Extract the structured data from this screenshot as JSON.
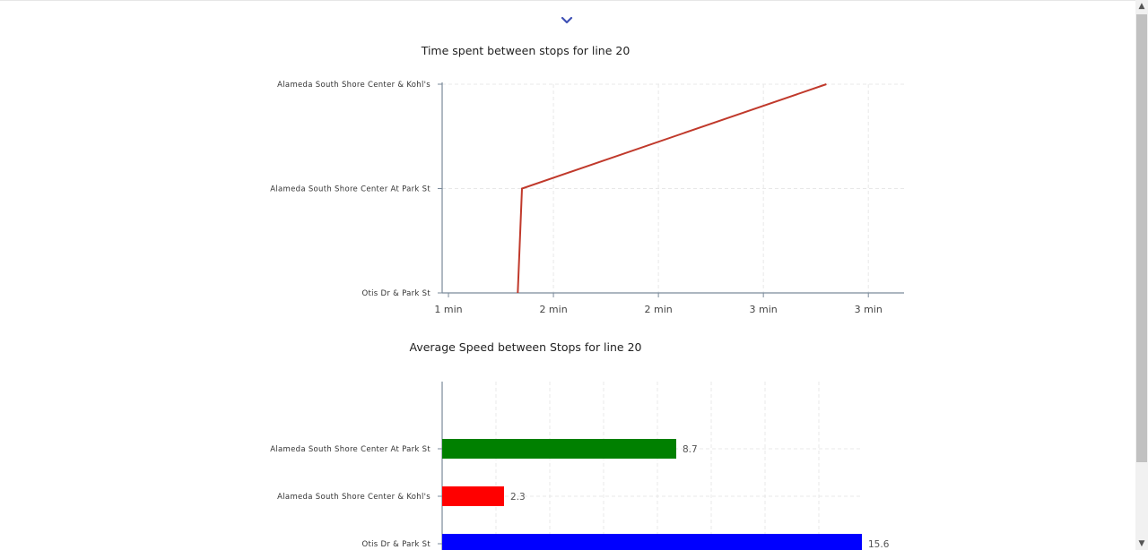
{
  "colors": {
    "line": "#c0392b",
    "axis": "#7a8a9a",
    "grid": "#e8e8e8",
    "chevron": "#3f51b5",
    "scrollbar_track": "#f1f1f1",
    "scrollbar_thumb": "#c1c1c1"
  },
  "icons": {
    "collapse": "chevron-down-icon",
    "scroll_up": "triangle-up-icon",
    "scroll_down": "triangle-down-icon"
  },
  "chart_data": [
    {
      "type": "line",
      "title": "Time spent between stops for line 20",
      "categories": [
        "Otis Dr & Park St",
        "Alameda South Shore Center At Park St",
        "Alameda South Shore Center & Kohl's"
      ],
      "x_tick_labels": [
        "1 min",
        "2 min",
        "2 min",
        "3 min",
        "3 min"
      ],
      "x_ticks": [
        1.0,
        1.5,
        2.0,
        2.5,
        3.0
      ],
      "xlim": [
        0.97,
        3.17
      ],
      "grid": true,
      "series": [
        {
          "x": [
            1.33,
            1.35,
            2.8
          ],
          "y": [
            0,
            1,
            2
          ]
        }
      ]
    },
    {
      "type": "bar",
      "orientation": "horizontal",
      "title": "Average Speed between Stops for line 20",
      "categories": [
        "Alameda South Shore Center At Park St",
        "Alameda South Shore Center & Kohl's",
        "Otis Dr & Park St"
      ],
      "values": [
        8.7,
        2.3,
        15.6
      ],
      "value_labels": [
        "8.7",
        "2.3",
        "15.6"
      ],
      "bar_colors": [
        "#008000",
        "#ff0000",
        "#0000ff"
      ],
      "xlim": [
        0,
        15.6
      ],
      "grid": true
    }
  ]
}
